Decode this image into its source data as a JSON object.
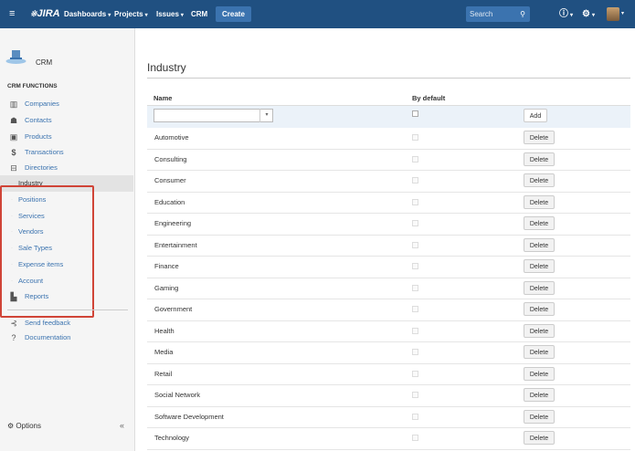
{
  "topbar": {
    "menu_icon": "hamburger-icon",
    "logo_text": "JIRA",
    "dashboards": "Dashboards",
    "projects": "Projects",
    "issues": "Issues",
    "crm": "CRM",
    "create": "Create",
    "search_placeholder": "Search",
    "caret": "▾"
  },
  "sidebar": {
    "project_name": "CRM",
    "section_title": "CRM FUNCTIONS",
    "items": [
      {
        "label": "Companies",
        "icon": "building-icon"
      },
      {
        "label": "Contacts",
        "icon": "contacts-icon"
      },
      {
        "label": "Products",
        "icon": "box-icon"
      },
      {
        "label": "Transactions",
        "icon": "dollar-icon"
      },
      {
        "label": "Directories",
        "icon": "folder-icon"
      }
    ],
    "directories": [
      "Industry",
      "Positions",
      "Services",
      "Vendors",
      "Sale Types",
      "Expense items",
      "Account"
    ],
    "reports": "Reports",
    "send_feedback": "Send feedback",
    "documentation": "Documentation",
    "options": "Options",
    "collapse": "«"
  },
  "main": {
    "title": "Industry",
    "col_name": "Name",
    "col_default": "By default",
    "add_button": "Add",
    "delete_label": "Delete",
    "rows": [
      "Automotive",
      "Consulting",
      "Consumer",
      "Education",
      "Engineering",
      "Entertainment",
      "Finance",
      "Gaming",
      "Government",
      "Health",
      "Media",
      "Retail",
      "Social Network",
      "Software Development",
      "Technology"
    ]
  },
  "colors": {
    "topbar": "#205081",
    "highlight_box": "#d04437",
    "link": "#3b73af"
  }
}
